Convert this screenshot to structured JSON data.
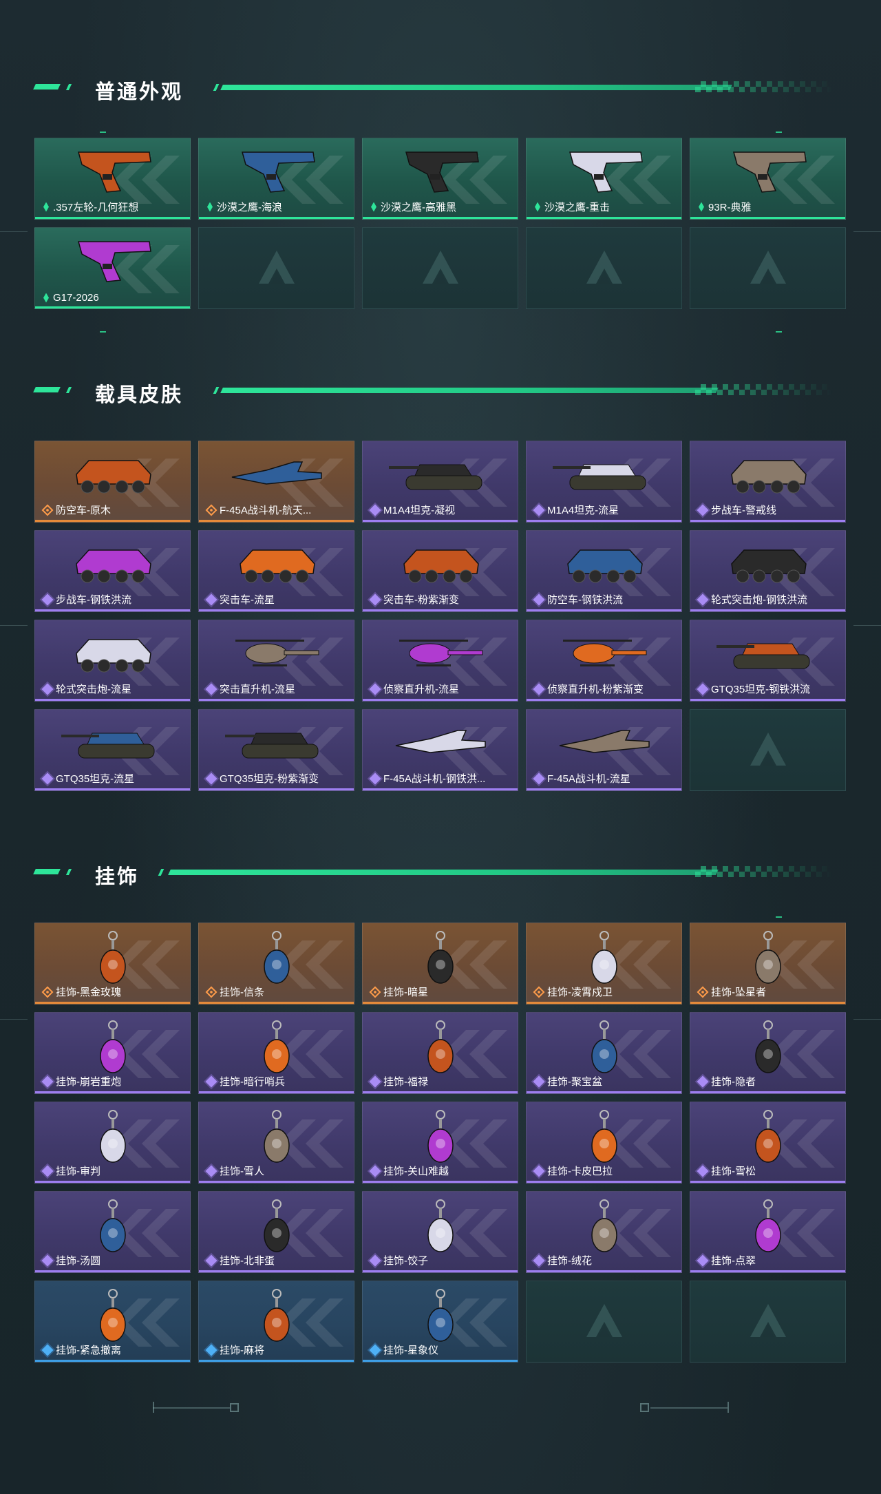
{
  "sections": {
    "normal": {
      "title": "普通外观"
    },
    "vehicle": {
      "title": "载具皮肤"
    },
    "charm": {
      "title": "挂饰"
    }
  },
  "normal_items": [
    {
      "label": ".357左轮-几何狂想",
      "rarity": "green",
      "icon": "revolver-icon"
    },
    {
      "label": "沙漠之鹰-海浪",
      "rarity": "green",
      "icon": "pistol-icon"
    },
    {
      "label": "沙漠之鹰-高雅黑",
      "rarity": "green",
      "icon": "pistol-icon"
    },
    {
      "label": "沙漠之鹰-重击",
      "rarity": "green",
      "icon": "pistol-icon"
    },
    {
      "label": "93R-典雅",
      "rarity": "green",
      "icon": "pistol-icon"
    },
    {
      "label": "G17-2026",
      "rarity": "green",
      "icon": "pistol-icon"
    },
    {
      "label": "",
      "rarity": "empty"
    },
    {
      "label": "",
      "rarity": "empty"
    },
    {
      "label": "",
      "rarity": "empty"
    },
    {
      "label": "",
      "rarity": "empty"
    }
  ],
  "vehicle_items": [
    {
      "label": "防空车-原木",
      "rarity": "orange",
      "icon": "armored-car-icon"
    },
    {
      "label": "F-45A战斗机-航天...",
      "rarity": "orange",
      "icon": "jet-icon"
    },
    {
      "label": "M1A4坦克-凝视",
      "rarity": "purple",
      "icon": "tank-icon"
    },
    {
      "label": "M1A4坦克-流星",
      "rarity": "purple",
      "icon": "tank-icon"
    },
    {
      "label": "步战车-警戒线",
      "rarity": "purple",
      "icon": "armored-car-icon"
    },
    {
      "label": "步战车-钢铁洪流",
      "rarity": "purple",
      "icon": "armored-car-icon"
    },
    {
      "label": "突击车-流星",
      "rarity": "purple",
      "icon": "jeep-icon"
    },
    {
      "label": "突击车-粉紫渐变",
      "rarity": "purple",
      "icon": "jeep-icon"
    },
    {
      "label": "防空车-钢铁洪流",
      "rarity": "purple",
      "icon": "armored-car-icon"
    },
    {
      "label": "轮式突击炮-钢铁洪流",
      "rarity": "purple",
      "icon": "armored-car-icon"
    },
    {
      "label": "轮式突击炮-流星",
      "rarity": "purple",
      "icon": "jeep-icon"
    },
    {
      "label": "突击直升机-流星",
      "rarity": "purple",
      "icon": "helicopter-icon"
    },
    {
      "label": "侦察直升机-流星",
      "rarity": "purple",
      "icon": "helicopter-icon"
    },
    {
      "label": "侦察直升机-粉紫渐变",
      "rarity": "purple",
      "icon": "helicopter-icon"
    },
    {
      "label": "GTQ35坦克-钢铁洪流",
      "rarity": "purple",
      "icon": "tank-icon"
    },
    {
      "label": "GTQ35坦克-流星",
      "rarity": "purple",
      "icon": "tank-icon"
    },
    {
      "label": "GTQ35坦克-粉紫渐变",
      "rarity": "purple",
      "icon": "tank-icon"
    },
    {
      "label": "F-45A战斗机-钢铁洪...",
      "rarity": "purple",
      "icon": "jet-icon"
    },
    {
      "label": "F-45A战斗机-流星",
      "rarity": "purple",
      "icon": "jet-icon"
    },
    {
      "label": "",
      "rarity": "empty"
    }
  ],
  "charm_items": [
    {
      "label": "挂饰-黑金玫瑰",
      "rarity": "orange",
      "icon": "charm-icon"
    },
    {
      "label": "挂饰-信条",
      "rarity": "orange",
      "icon": "charm-icon"
    },
    {
      "label": "挂饰-暗星",
      "rarity": "orange",
      "icon": "charm-icon"
    },
    {
      "label": "挂饰-凌霄戍卫",
      "rarity": "orange",
      "icon": "charm-icon"
    },
    {
      "label": "挂饰-坠星者",
      "rarity": "orange",
      "icon": "charm-icon"
    },
    {
      "label": "挂饰-崩岩重炮",
      "rarity": "purple",
      "icon": "charm-icon"
    },
    {
      "label": "挂饰-暗行哨兵",
      "rarity": "purple",
      "icon": "charm-icon"
    },
    {
      "label": "挂饰-福禄",
      "rarity": "purple",
      "icon": "charm-icon"
    },
    {
      "label": "挂饰-聚宝盆",
      "rarity": "purple",
      "icon": "charm-icon"
    },
    {
      "label": "挂饰-隐者",
      "rarity": "purple",
      "icon": "charm-icon"
    },
    {
      "label": "挂饰-审判",
      "rarity": "purple",
      "icon": "charm-icon"
    },
    {
      "label": "挂饰-雪人",
      "rarity": "purple",
      "icon": "charm-icon"
    },
    {
      "label": "挂饰-关山难越",
      "rarity": "purple",
      "icon": "charm-icon"
    },
    {
      "label": "挂饰-卡皮巴拉",
      "rarity": "purple",
      "icon": "charm-icon"
    },
    {
      "label": "挂饰-雪松",
      "rarity": "purple",
      "icon": "charm-icon"
    },
    {
      "label": "挂饰-汤圆",
      "rarity": "purple",
      "icon": "charm-icon"
    },
    {
      "label": "挂饰-北非蛋",
      "rarity": "purple",
      "icon": "charm-icon"
    },
    {
      "label": "挂饰-饺子",
      "rarity": "purple",
      "icon": "charm-icon"
    },
    {
      "label": "挂饰-绒花",
      "rarity": "purple",
      "icon": "charm-icon"
    },
    {
      "label": "挂饰-点翠",
      "rarity": "purple",
      "icon": "charm-icon"
    },
    {
      "label": "挂饰-紧急撤离",
      "rarity": "blue",
      "icon": "charm-icon"
    },
    {
      "label": "挂饰-麻将",
      "rarity": "blue",
      "icon": "charm-icon"
    },
    {
      "label": "挂饰-星象仪",
      "rarity": "blue",
      "icon": "charm-icon"
    },
    {
      "label": "",
      "rarity": "empty"
    },
    {
      "label": "",
      "rarity": "empty"
    }
  ],
  "colors": {
    "accent": "#2ee59a",
    "green": "#2ee59a",
    "orange": "#e58a3a",
    "purple": "#9d7ef0",
    "blue": "#3e9fe6"
  }
}
